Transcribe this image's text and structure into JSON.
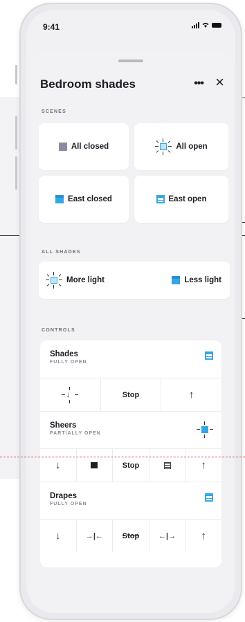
{
  "status_bar": {
    "time": "9:41"
  },
  "sheet": {
    "title": "Bedroom shades",
    "more_icon": "ellipsis-icon",
    "close_icon": "close-icon"
  },
  "scenes": {
    "label": "SCENES",
    "items": [
      {
        "label": "All closed",
        "icon": "shade-closed-gray-icon"
      },
      {
        "label": "All open",
        "icon": "shade-open-sun-icon"
      },
      {
        "label": "East closed",
        "icon": "shade-closed-blue-icon"
      },
      {
        "label": "East open",
        "icon": "shade-open-icon"
      }
    ]
  },
  "all_shades": {
    "label": "ALL SHADES",
    "more_light": "More light",
    "less_light": "Less light"
  },
  "controls": {
    "label": "CONTROLS",
    "groups": [
      {
        "name": "Shades",
        "state": "FULLY OPEN",
        "buttons": [
          "",
          "Stop",
          ""
        ]
      },
      {
        "name": "Sheers",
        "state": "PARTIALLY OPEN",
        "buttons": [
          "",
          "",
          "Stop",
          "",
          ""
        ]
      },
      {
        "name": "Drapes",
        "state": "FULLY OPEN",
        "buttons": [
          "",
          "",
          "Stop",
          "",
          ""
        ]
      }
    ]
  },
  "colors": {
    "accent": "#35a6e4",
    "gray_square": "#8c8ca0",
    "dashed_line": "#e0424d"
  }
}
